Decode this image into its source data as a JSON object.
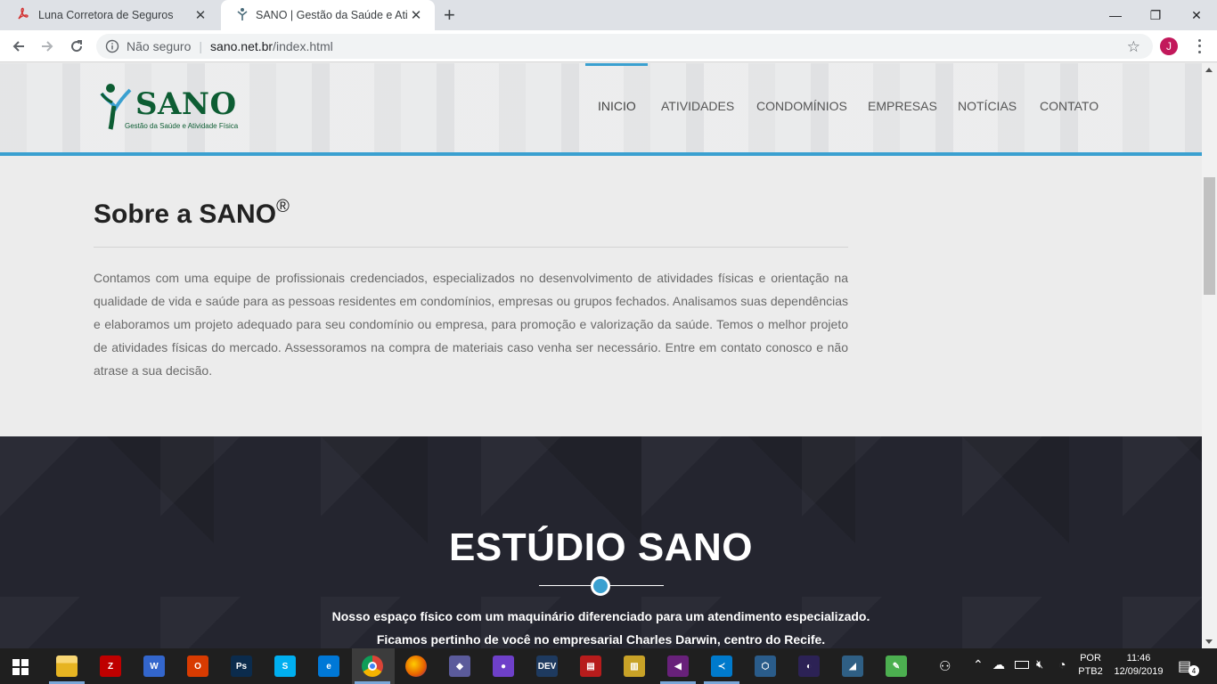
{
  "browser": {
    "tabs": [
      {
        "title": "Luna Corretora de Seguros",
        "icon": "acrobat-icon"
      },
      {
        "title": "SANO | Gestão da Saúde e Ativid",
        "icon": "sano-favicon"
      }
    ],
    "new_tab_label": "+",
    "address": {
      "security_label": "Não seguro",
      "separator": "|",
      "host": "sano.net.br",
      "path": "/index.html"
    },
    "avatar_letter": "J",
    "window_controls": {
      "minimize": "—",
      "restore": "❐",
      "close": "✕"
    }
  },
  "site": {
    "logo": {
      "word": "SANO",
      "tagline": "Gestão da Saúde e Atividade Física"
    },
    "nav": [
      {
        "label": "INICIO"
      },
      {
        "label": "ATIVIDADES"
      },
      {
        "label": "CONDOMÍNIOS"
      },
      {
        "label": "EMPRESAS"
      },
      {
        "label": "NOTÍCIAS"
      },
      {
        "label": "CONTATO"
      }
    ],
    "sobre": {
      "title": "Sobre a SANO",
      "title_mark": "®",
      "text": "Contamos com uma equipe de profissionais credenciados, especializados no desenvolvimento de atividades físicas e orientação na qualidade de vida e saúde para as pessoas residentes em condomínios, empresas ou grupos fechados. Analisamos suas dependências e elaboramos um projeto adequado para seu condomínio ou empresa, para promoção e valorização da saúde. Temos o melhor projeto de atividades físicas do mercado. Assessoramos na compra de materiais caso venha ser necessário. Entre em contato conosco e não atrase a sua decisão."
    },
    "estudio": {
      "title": "ESTÚDIO SANO",
      "line1": "Nosso espaço físico com um maquinário diferenciado para um atendimento especializado.",
      "line2": "Ficamos pertinho de você no empresarial Charles Darwin, centro do Recife."
    },
    "colors": {
      "accent": "#3aa0d0",
      "logo_green": "#0d5d33",
      "dark_section": "#24252f"
    }
  },
  "taskbar": {
    "apps": [
      {
        "name": "file-explorer-icon",
        "color": "#f4c542"
      },
      {
        "name": "filezilla-icon",
        "color": "#bf0000",
        "glyph": "Z"
      },
      {
        "name": "wps-icon",
        "color": "#3366cc",
        "glyph": "W"
      },
      {
        "name": "office-icon",
        "color": "#d83b01",
        "glyph": "O"
      },
      {
        "name": "photoshop-icon",
        "color": "#0b2b4c",
        "glyph": "Ps"
      },
      {
        "name": "skype-icon",
        "color": "#00aff0",
        "glyph": "S"
      },
      {
        "name": "edge-icon",
        "color": "#0078d7",
        "glyph": "e"
      },
      {
        "name": "chrome-icon",
        "color": "#4caf50",
        "glyph": ""
      },
      {
        "name": "firefox-icon",
        "color": "#e66000",
        "glyph": ""
      },
      {
        "name": "git-icon",
        "color": "#5b5b9b",
        "glyph": "◆"
      },
      {
        "name": "github-desktop-icon",
        "color": "#6e40c9",
        "glyph": "●"
      },
      {
        "name": "devpaste-icon",
        "color": "#1e3a5f",
        "glyph": "DEV"
      },
      {
        "name": "heidisql-icon",
        "color": "#b71c1c",
        "glyph": "▤"
      },
      {
        "name": "db-tool-icon",
        "color": "#c8a227",
        "glyph": "▥"
      },
      {
        "name": "visual-studio-icon",
        "color": "#68217a",
        "glyph": "◀"
      },
      {
        "name": "vscode-icon",
        "color": "#007acc",
        "glyph": "≺"
      },
      {
        "name": "virtualbox-icon",
        "color": "#2a5c8a",
        "glyph": "⬡"
      },
      {
        "name": "eclipse-icon",
        "color": "#2c2255",
        "glyph": "◐"
      },
      {
        "name": "mysql-workbench-icon",
        "color": "#2f5f84",
        "glyph": "◢"
      },
      {
        "name": "notepad-icon",
        "color": "#4caf50",
        "glyph": "✎"
      }
    ],
    "tray": {
      "lang_line1": "POR",
      "lang_line2": "PTB2",
      "time": "11:46",
      "date": "12/09/2019",
      "notifications": "4"
    }
  }
}
